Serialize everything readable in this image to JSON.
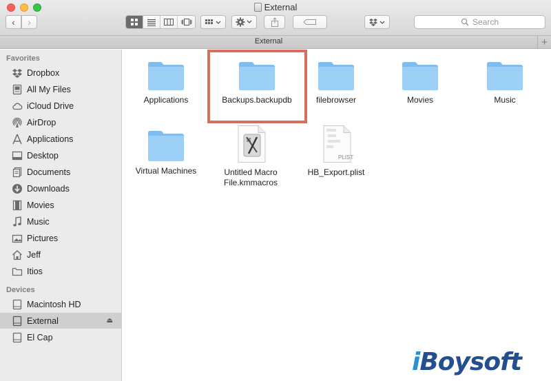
{
  "window": {
    "title": "External"
  },
  "toolbar": {
    "back_label": "‹",
    "forward_label": "›",
    "search_placeholder": "Search"
  },
  "tabbar": {
    "label": "External",
    "add_label": "+"
  },
  "sidebar": {
    "favorites_header": "Favorites",
    "favorites": [
      {
        "label": "Dropbox",
        "icon": "dropbox-icon"
      },
      {
        "label": "All My Files",
        "icon": "all-files-icon"
      },
      {
        "label": "iCloud Drive",
        "icon": "cloud-icon"
      },
      {
        "label": "AirDrop",
        "icon": "airdrop-icon"
      },
      {
        "label": "Applications",
        "icon": "applications-icon"
      },
      {
        "label": "Desktop",
        "icon": "desktop-icon"
      },
      {
        "label": "Documents",
        "icon": "documents-icon"
      },
      {
        "label": "Downloads",
        "icon": "downloads-icon"
      },
      {
        "label": "Movies",
        "icon": "movies-icon"
      },
      {
        "label": "Music",
        "icon": "music-icon"
      },
      {
        "label": "Pictures",
        "icon": "pictures-icon"
      },
      {
        "label": "Jeff",
        "icon": "home-icon"
      },
      {
        "label": "Itios",
        "icon": "folder-icon"
      }
    ],
    "devices_header": "Devices",
    "devices": [
      {
        "label": "Macintosh HD",
        "icon": "hard-drive-icon",
        "selected": false
      },
      {
        "label": "External",
        "icon": "external-drive-icon",
        "selected": true
      },
      {
        "label": "El Cap",
        "icon": "hard-drive-icon",
        "selected": false
      }
    ]
  },
  "files": [
    {
      "label": "Applications",
      "type": "folder"
    },
    {
      "label": "Backups.backupdb",
      "type": "folder",
      "highlighted": true
    },
    {
      "label": "filebrowser",
      "type": "folder"
    },
    {
      "label": "Movies",
      "type": "folder"
    },
    {
      "label": "Music",
      "type": "folder"
    },
    {
      "label": "Virtual Machines",
      "type": "folder"
    },
    {
      "label": "Untitled Macro File.kmmacros",
      "type": "document"
    },
    {
      "label": "HB_Export.plist",
      "type": "plist",
      "badge": "PLIST"
    }
  ],
  "watermark": {
    "prefix": "i",
    "text": "Boysoft"
  },
  "colors": {
    "folder": "#8ec7f2",
    "highlight": "#d86f5c",
    "watermark": "#244f8f"
  }
}
